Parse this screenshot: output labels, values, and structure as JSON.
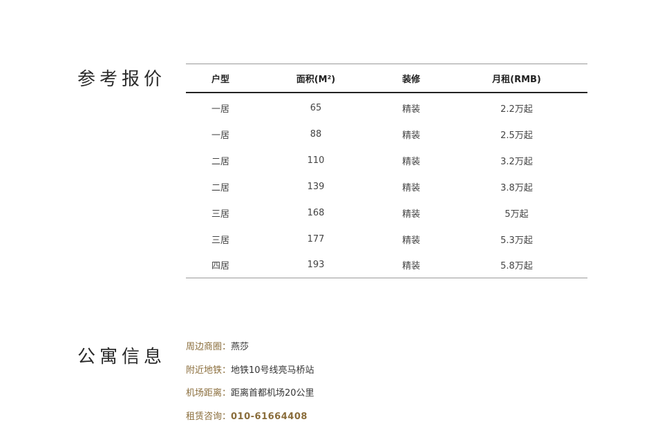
{
  "price_section": {
    "title": "参考报价",
    "headers": {
      "type": "户型",
      "area": "面积(M²)",
      "decoration": "装修",
      "rent": "月租(RMB)"
    },
    "rows": [
      {
        "type": "一居",
        "area": "65",
        "decoration": "精装",
        "rent": "2.2万起"
      },
      {
        "type": "一居",
        "area": "88",
        "decoration": "精装",
        "rent": "2.5万起"
      },
      {
        "type": "二居",
        "area": "110",
        "decoration": "精装",
        "rent": "3.2万起"
      },
      {
        "type": "二居",
        "area": "139",
        "decoration": "精装",
        "rent": "3.8万起"
      },
      {
        "type": "三居",
        "area": "168",
        "decoration": "精装",
        "rent": "5万起"
      },
      {
        "type": "三居",
        "area": "177",
        "decoration": "精装",
        "rent": "5.3万起"
      },
      {
        "type": "四居",
        "area": "193",
        "decoration": "精装",
        "rent": "5.8万起"
      }
    ]
  },
  "info_section": {
    "title": "公寓信息",
    "items": [
      {
        "label": "周边商圈：",
        "value": "燕莎"
      },
      {
        "label": "附近地铁：",
        "value": "地铁10号线亮马桥站"
      },
      {
        "label": "机场距离：",
        "value": "距离首都机场20公里"
      },
      {
        "label": "租赁咨询：",
        "value": "010-61664408"
      }
    ]
  },
  "colors": {
    "label_gold": "#8a6d3b",
    "text_dark": "#333333",
    "rule_dark": "#222222",
    "rule_light": "#999999"
  }
}
